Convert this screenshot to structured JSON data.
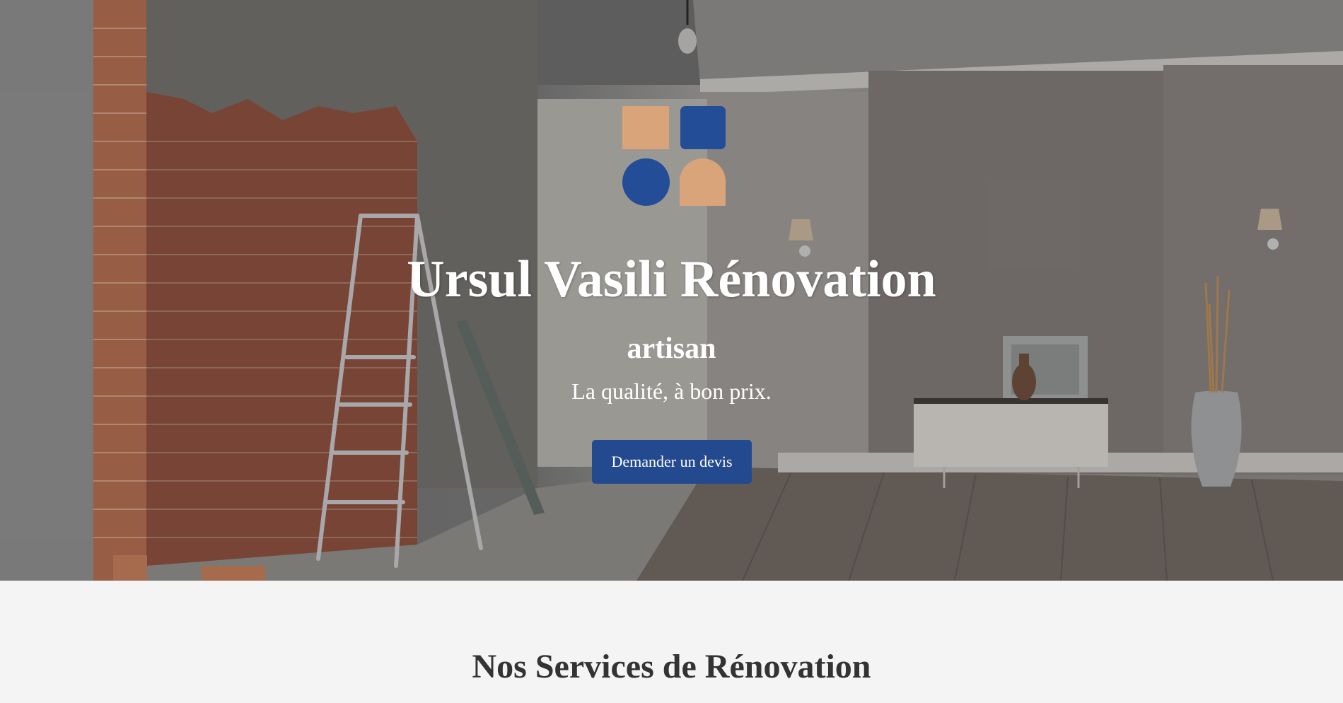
{
  "hero": {
    "title": "Ursul Vasili Rénovation",
    "subtitle": "artisan",
    "tagline": "La qualité, à bon prix.",
    "cta_label": "Demander un devis"
  },
  "services": {
    "title": "Nos Services de Rénovation"
  },
  "colors": {
    "accent_blue": "#234a8f",
    "logo_tan": "#d9a47a",
    "logo_blue": "#234d96",
    "section_bg": "#f4f4f4",
    "heading_text": "#333333"
  },
  "icons": [
    "logo-square-icon",
    "logo-rounded-square-icon",
    "logo-circle-icon",
    "logo-arch-icon"
  ]
}
